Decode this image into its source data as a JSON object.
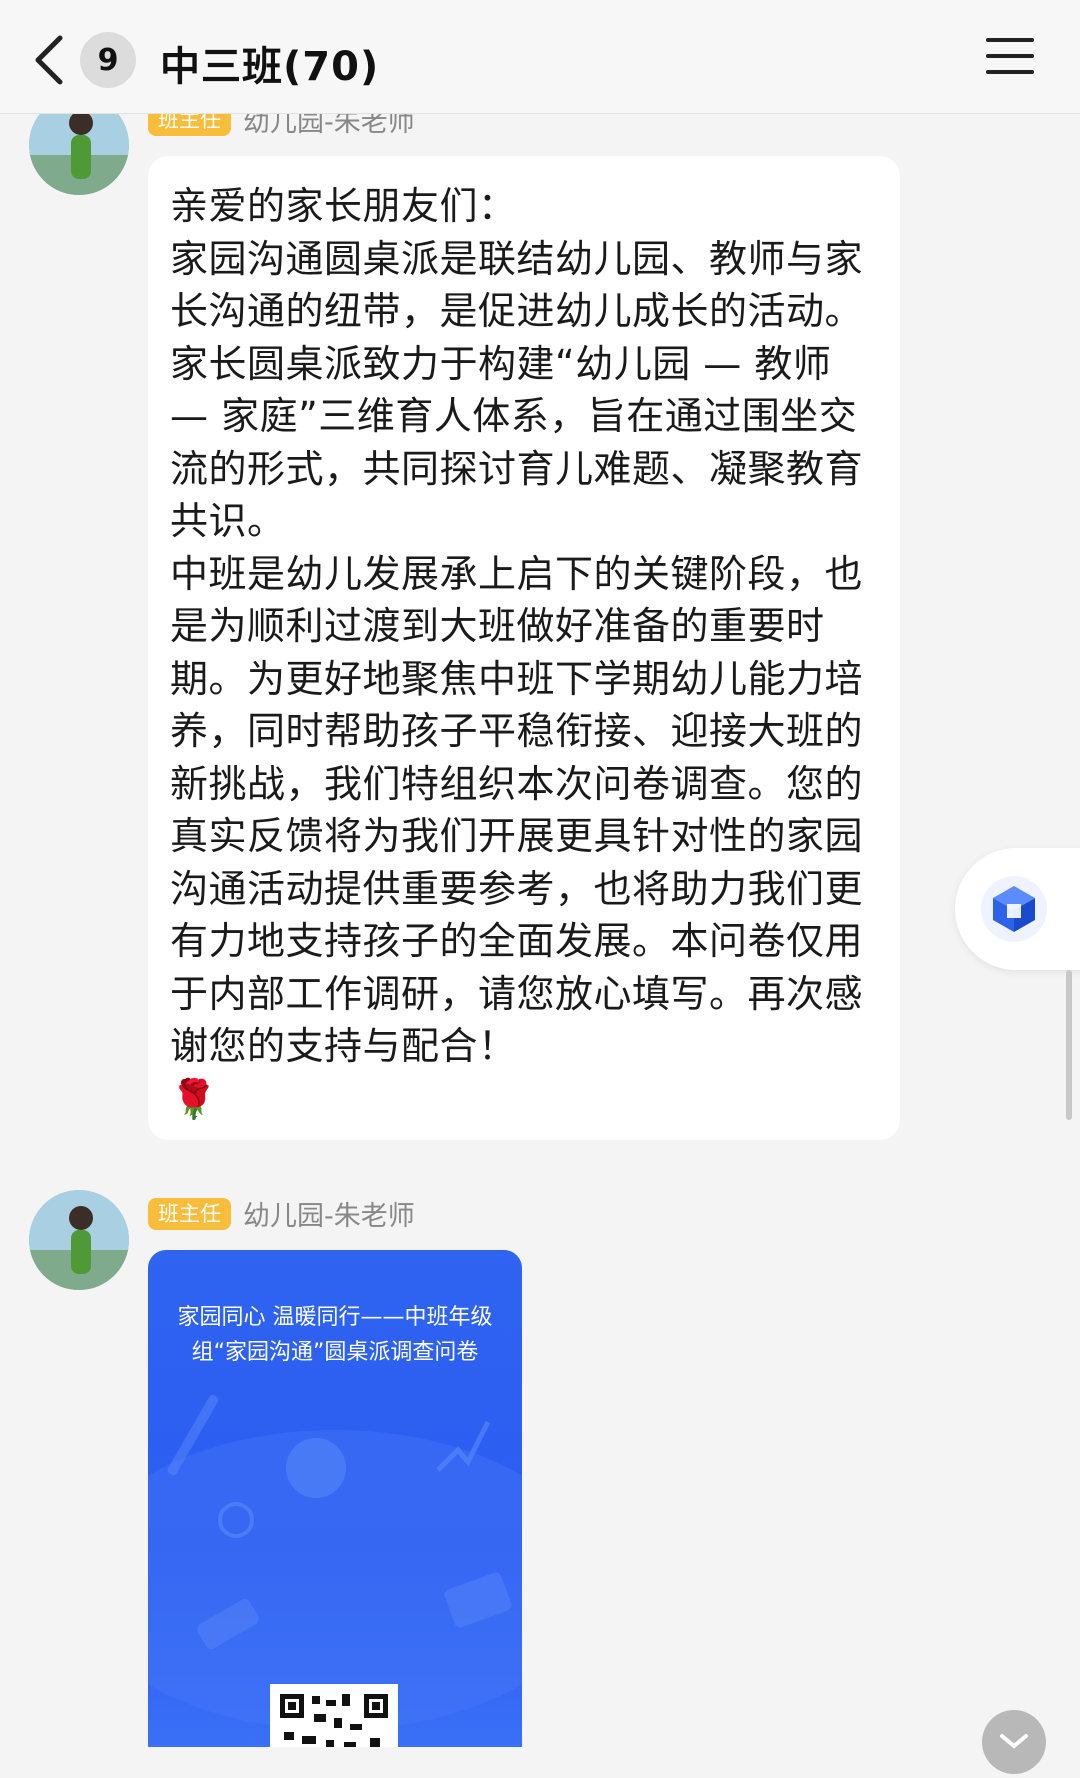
{
  "header": {
    "unread_count": "9",
    "title": "中三班(70)"
  },
  "messages": [
    {
      "role": "班主任",
      "sender": "幼儿园-朱老师",
      "paragraphs": [
        "亲爱的家长朋友们：",
        "家园沟通圆桌派是联结幼儿园、教师与家长沟通的纽带，是促进幼儿成长的活动。家长圆桌派致力于构建“幼儿园 — 教师 — 家庭”三维育人体系，旨在通过围坐交流的形式，共同探讨育儿难题、凝聚教育共识。",
        "中班是幼儿发展承上启下的关键阶段，也是为顺利过渡到大班做好准备的重要时期。为更好地聚焦中班下学期幼儿能力培养，同时帮助孩子平稳衔接、迎接大班的新挑战，我们特组织本次问卷调查。您的真实反馈将为我们开展更具针对性的家园沟通活动提供重要参考，也将助力我们更有力地支持孩子的全面发展。本问卷仅用于内部工作调研，请您放心填写。再次感谢您的支持与配合！"
      ],
      "emoji": "🌹"
    },
    {
      "role": "班主任",
      "sender": "幼儿园-朱老师",
      "card_title": "家园同心 温暖同行——中班年级组“家园沟通”圆桌派调查问卷"
    }
  ],
  "colors": {
    "role_badge": "#f8bd3a",
    "card_blue": "#2f63f0",
    "bubble": "#ffffff",
    "background": "#f4f4f4"
  },
  "icons": {
    "back": "chevron-left-icon",
    "menu": "hamburger-menu-icon",
    "float": "cube-app-icon",
    "collapse": "chevron-down-icon"
  }
}
